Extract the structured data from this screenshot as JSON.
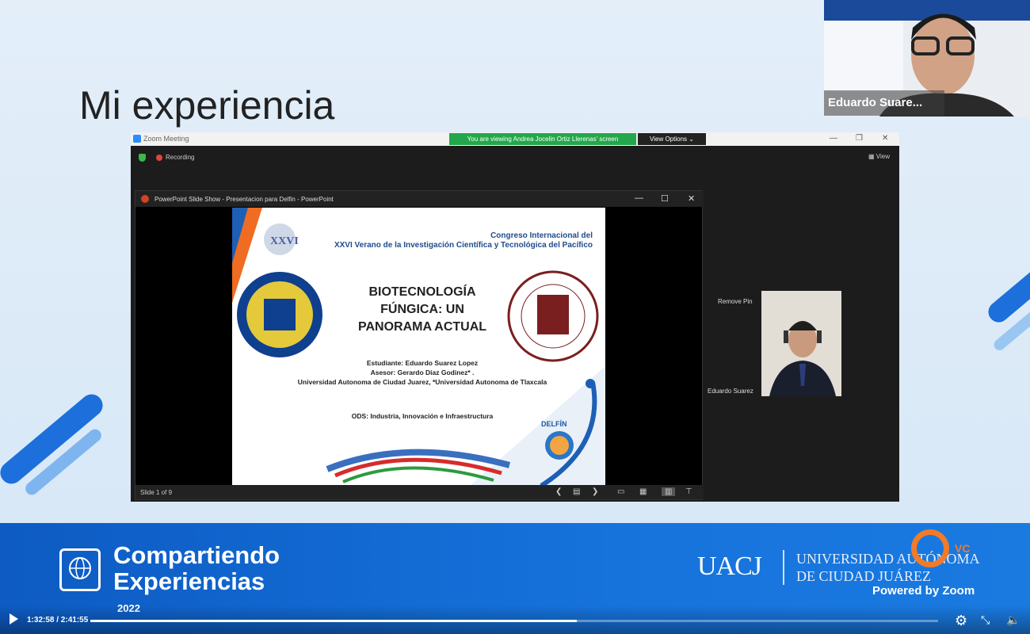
{
  "slide": {
    "title": "Mi experiencia"
  },
  "zoom": {
    "title": "Zoom Meeting",
    "viewing_banner": "You are viewing Andrea Jocelin Ortiz Llerenas' screen",
    "view_options": "View Options ⌄",
    "recording": "Recording",
    "view": "▦ View",
    "remove_pin": "Remove Pin",
    "participant_name": "Eduardo Suarez"
  },
  "ppt": {
    "title": "PowerPoint Slide Show  -  Presentacion para Delfin  -  PowerPoint",
    "slide_counter": "Slide 1 of 9"
  },
  "slide_content": {
    "congress_line1": "Congreso Internacional del",
    "congress_line2": "XXVI Verano de la Investigación Científica y Tecnológica del Pacífico",
    "main_title": "BIOTECNOLOGÍA FÚNGICA: UN PANORAMA ACTUAL",
    "student": "Estudiante: Eduardo Suarez Lopez",
    "advisor": "Asesor: Gerardo Diaz Godinez* .",
    "universities": "Universidad Autonoma de Ciudad Juarez, *Universidad Autonoma de Tlaxcala",
    "ods": "ODS: Industria, Innovación e Infraestructura",
    "delfin": "DELFÍN"
  },
  "camera": {
    "name": "Eduardo Suare..."
  },
  "banner": {
    "line1": "Compartiendo",
    "line2": "Experiencias",
    "year": "2022",
    "uacj": "UACJ",
    "univ_line1": "UNIVERSIDAD AUTÓNOMA",
    "univ_line2": "DE CIUDAD JUÁREZ",
    "powered": "Powered by Zoom",
    "vc": "VC"
  },
  "player": {
    "time": "1:32:58 / 2:41:55",
    "progress_fraction": 0.5739
  }
}
